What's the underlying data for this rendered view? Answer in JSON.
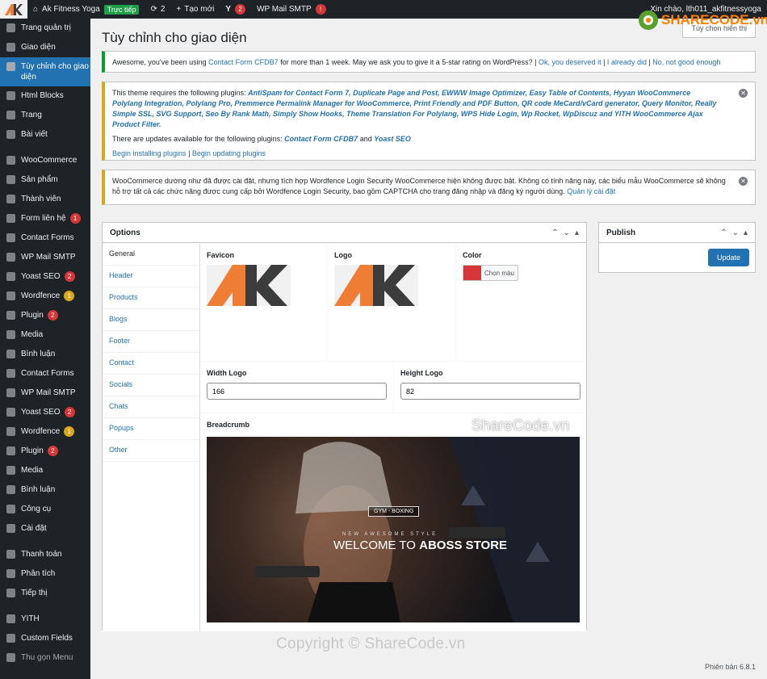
{
  "adminbar": {
    "site_name": "Ak Fitness Yoga",
    "live_label": "Trực tiếp",
    "updates_count": "2",
    "new_label": "Tạo mới",
    "yoast_count": "2",
    "smtp_label": "WP Mail SMTP",
    "smtp_alert": "!",
    "greeting": "Xin chào, lth011_akfitnessyoga"
  },
  "sidebar": {
    "items": [
      {
        "label": "Trang quản trị",
        "icon": "dashboard-icon"
      },
      {
        "label": "Giao diện",
        "icon": "paintbrush-icon"
      },
      {
        "label": "Tùy chỉnh cho giao diện",
        "icon": "gear-icon"
      },
      {
        "label": "Html Blocks",
        "icon": "blocks-icon"
      },
      {
        "label": "Trang",
        "icon": "page-icon"
      },
      {
        "label": "Bài viết",
        "icon": "pin-icon"
      },
      {
        "label": "WooCommerce",
        "icon": "woo-icon"
      },
      {
        "label": "Sản phẩm",
        "icon": "archive-icon"
      },
      {
        "label": "Thành viên",
        "icon": "users-icon"
      },
      {
        "label": "Form liên hệ",
        "icon": "mail-icon",
        "badge": "1"
      },
      {
        "label": "Contact Forms",
        "icon": "forms-icon"
      },
      {
        "label": "WP Mail SMTP",
        "icon": "mail-icon"
      },
      {
        "label": "Yoast SEO",
        "icon": "yoast-icon",
        "badge": "2"
      },
      {
        "label": "Wordfence",
        "icon": "wordfence-icon",
        "badge": "1",
        "badge_color": "orange"
      },
      {
        "label": "Plugin",
        "icon": "plugin-icon",
        "badge": "2"
      },
      {
        "label": "Media",
        "icon": "media-icon"
      },
      {
        "label": "Bình luận",
        "icon": "comment-icon"
      },
      {
        "label": "Contact Forms",
        "icon": "forms-icon"
      },
      {
        "label": "WP Mail SMTP",
        "icon": "mail-icon"
      },
      {
        "label": "Yoast SEO",
        "icon": "yoast-icon",
        "badge": "2"
      },
      {
        "label": "Wordfence",
        "icon": "wordfence-icon",
        "badge": "1",
        "badge_color": "orange"
      },
      {
        "label": "Plugin",
        "icon": "plugin-icon",
        "badge": "2"
      },
      {
        "label": "Media",
        "icon": "media-icon"
      },
      {
        "label": "Bình luận",
        "icon": "comment-icon"
      },
      {
        "label": "Công cụ",
        "icon": "wrench-icon"
      },
      {
        "label": "Cài đặt",
        "icon": "settings-icon"
      },
      {
        "label": "Thanh toán",
        "icon": "dollar-icon"
      },
      {
        "label": "Phân tích",
        "icon": "chart-icon"
      },
      {
        "label": "Tiếp thị",
        "icon": "megaphone-icon"
      },
      {
        "label": "YITH",
        "icon": "yith-icon"
      },
      {
        "label": "Custom Fields",
        "icon": "fields-icon"
      },
      {
        "label": "Thu gọn Menu",
        "icon": "collapse-icon"
      }
    ]
  },
  "page": {
    "title": "Tùy chỉnh cho giao diện",
    "screen_options": "Tùy chọn hiển thị",
    "version": "Phiên bản 6.8.1"
  },
  "notice_rating": {
    "text_before": "Awesome, you've been using",
    "plugin_link": "Contact Form CFDB7",
    "text_after": "for more than 1 week. May we ask you to give it a 5-star rating on WordPress? |",
    "link1": "Ok, you deserved it",
    "link2": "I already did",
    "link3": "No, not good enough"
  },
  "notice_plugins": {
    "intro": "This theme requires the following plugins:",
    "plugins_line": "AntiSpam for Contact Form 7, Duplicate Page and Post, EWWW Image Optimizer, Easy Table of Contents, Hyyan WooCommerce Polylang Integration, Polylang Pro, Premmerce Permalink Manager for WooCommerce, Print Friendly and PDF Button, QR code MeCard/vCard generator, Query Monitor, Really Simple SSL, SVG Support, Seo By Rank Math, Simply Show Hooks, Theme Translation For Polylang, WPS Hide Login, Wp Rocket, WpDiscuz and YITH WooCommerce Ajax Product Filter.",
    "updates_intro": "There are updates available for the following plugins:",
    "update1": "Contact Form CFDB7",
    "and_text": "and",
    "update2": "Yoast SEO",
    "begin_install": "Begin installing plugins",
    "begin_update": "Begin updating plugins"
  },
  "notice_wordfence": {
    "text": "WooCommerce dường như đã được cài đặt, nhưng tích hợp Wordfence Login Security WooCommerce hiện không được bật. Không có tính năng này, các biểu mẫu WooCommerce sẽ không hỗ trợ tất cả các chức năng được cung cấp bởi Wordfence Login Security, bao gồm CAPTCHA cho trang đăng nhập và đăng ký người dùng.",
    "link": "Quản lý cài đặt"
  },
  "options": {
    "title": "Options",
    "tabs": [
      "General",
      "Header",
      "Products",
      "Blogs",
      "Footer",
      "Contact",
      "Socials",
      "Chats",
      "Popups",
      "Other"
    ],
    "favicon_label": "Favicon",
    "logo_label": "Logo",
    "color_label": "Color",
    "color_button": "Chọn màu",
    "color_value": "#d63638",
    "width_label": "Width Logo",
    "width_value": "166",
    "height_label": "Height Logo",
    "height_value": "82",
    "breadcrumb_label": "Breadcrumb",
    "banner": {
      "badge": "GYM - BOXING",
      "small_text": "NEW AWESOME STYLE",
      "welcome": "WELCOME TO ",
      "store": "ABOSS STORE"
    }
  },
  "publish": {
    "title": "Publish",
    "button": "Update"
  },
  "watermarks": {
    "logo_text": "SHARECODE.vn",
    "mid_text": "ShareCode.vn",
    "bottom_text": "Copyright © ShareCode.vn"
  }
}
